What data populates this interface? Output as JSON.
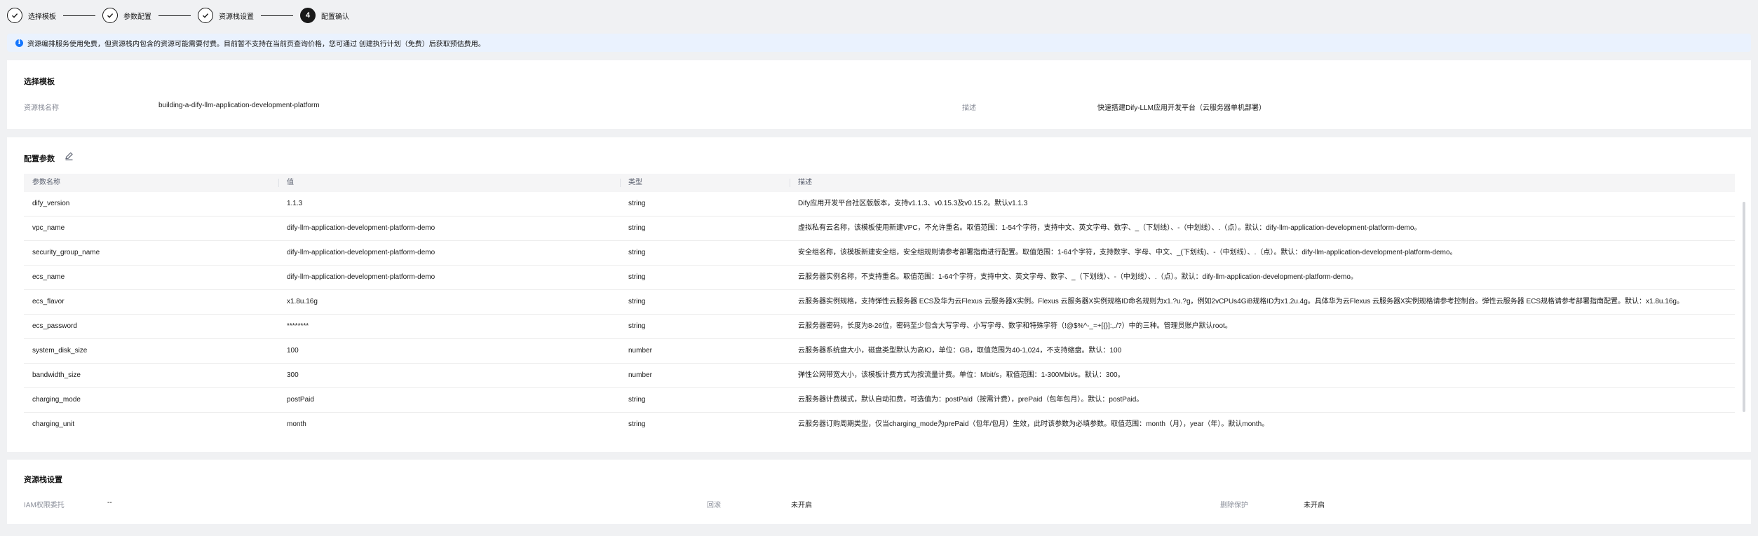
{
  "steps": [
    {
      "label": "选择模板",
      "state": "done"
    },
    {
      "label": "参数配置",
      "state": "done"
    },
    {
      "label": "资源栈设置",
      "state": "done"
    },
    {
      "label": "配置确认",
      "state": "active",
      "number": "4"
    }
  ],
  "banner": {
    "text": "资源编排服务使用免费，但资源栈内包含的资源可能需要付费。目前暂不支持在当前页查询价格，您可通过 创建执行计划（免费）后获取预估费用。",
    "icon": "info-icon"
  },
  "template_section": {
    "title": "选择模板",
    "stack_name_label": "资源栈名称",
    "stack_name_value": "building-a-dify-llm-application-development-platform",
    "desc_label": "描述",
    "desc_value": "快速搭建Dify-LLM应用开发平台（云服务器单机部署）"
  },
  "params_section": {
    "title": "配置参数",
    "columns": [
      "参数名称",
      "值",
      "类型",
      "描述"
    ],
    "rows": [
      [
        "dify_version",
        "1.1.3",
        "string",
        "Dify应用开发平台社区版版本，支持v1.1.3、v0.15.3及v0.15.2。默认v1.1.3"
      ],
      [
        "vpc_name",
        "dify-llm-application-development-platform-demo",
        "string",
        "虚拟私有云名称，该模板使用新建VPC，不允许重名。取值范围：1-54个字符，支持中文、英文字母、数字、_（下划线）、-（中划线）、.（点）。默认：dify-llm-application-development-platform-demo。"
      ],
      [
        "security_group_name",
        "dify-llm-application-development-platform-demo",
        "string",
        "安全组名称，该模板新建安全组，安全组规则请参考部署指南进行配置。取值范围：1-64个字符，支持数字、字母、中文、_(下划线)、-（中划线）、.（点）。默认：dify-llm-application-development-platform-demo。"
      ],
      [
        "ecs_name",
        "dify-llm-application-development-platform-demo",
        "string",
        "云服务器实例名称，不支持重名。取值范围：1-64个字符，支持中文、英文字母、数字、_（下划线）、-（中划线）、.（点）。默认：dify-llm-application-development-platform-demo。"
      ],
      [
        "ecs_flavor",
        "x1.8u.16g",
        "string",
        "云服务器实例规格，支持弹性云服务器 ECS及华为云Flexus 云服务器X实例。Flexus 云服务器X实例规格ID命名规则为x1.?u.?g，例如2vCPUs4GiB规格ID为x1.2u.4g。具体华为云Flexus 云服务器X实例规格请参考控制台。弹性云服务器 ECS规格请参考部署指南配置。默认：x1.8u.16g。"
      ],
      [
        "ecs_password",
        "********",
        "string",
        "云服务器密码，长度为8-26位，密码至少包含大写字母、小写字母、数字和特殊字符（!@$%^-_=+[{}]:,./?）中的三种。管理员账户默认root。"
      ],
      [
        "system_disk_size",
        "100",
        "number",
        "云服务器系统盘大小，磁盘类型默认为高IO，单位：GB，取值范围为40-1,024，不支持缩盘。默认：100"
      ],
      [
        "bandwidth_size",
        "300",
        "number",
        "弹性公网带宽大小，该模板计费方式为按流量计费。单位：Mbit/s，取值范围：1-300Mbit/s。默认：300。"
      ],
      [
        "charging_mode",
        "postPaid",
        "string",
        "云服务器计费模式，默认自动扣费，可选值为：postPaid（按需计费），prePaid（包年包月）。默认：postPaid。"
      ],
      [
        "charging_unit",
        "month",
        "string",
        "云服务器订购周期类型，仅当charging_mode为prePaid（包年/包月）生效，此时该参数为必填参数。取值范围：month（月），year（年）。默认month。"
      ]
    ]
  },
  "stack_settings": {
    "title": "资源栈设置",
    "iam_label": "IAM权限委托",
    "iam_value": "--",
    "rollback_label": "回滚",
    "rollback_value": "未开启",
    "delete_protect_label": "删除保护",
    "delete_protect_value": "未开启"
  }
}
